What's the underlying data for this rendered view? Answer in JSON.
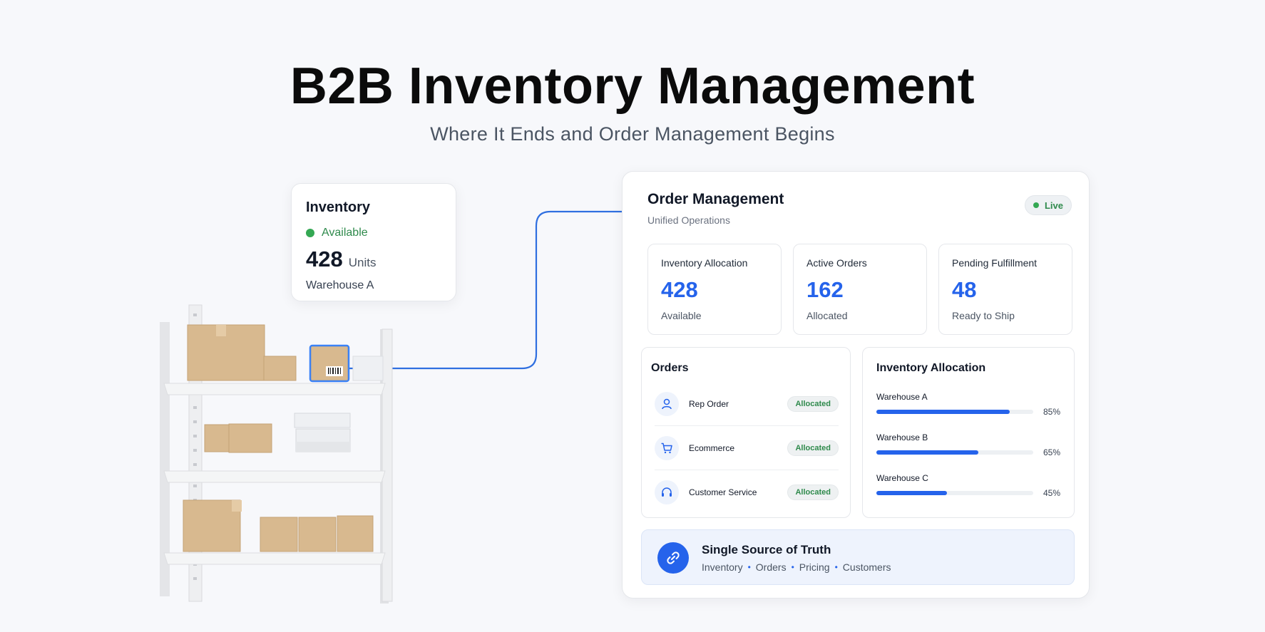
{
  "page": {
    "title": "B2B Inventory Management",
    "subtitle": "Where It Ends and Order Management Begins"
  },
  "inventory_card": {
    "title": "Inventory",
    "status": "Available",
    "quantity": "428",
    "unit": "Units",
    "warehouse": "Warehouse A"
  },
  "order_panel": {
    "title": "Order Management",
    "subtitle": "Unified Operations",
    "live_badge": "Live",
    "stats": [
      {
        "label": "Inventory Allocation",
        "value": "428",
        "sub": "Available"
      },
      {
        "label": "Active Orders",
        "value": "162",
        "sub": "Allocated"
      },
      {
        "label": "Pending Fulfillment",
        "value": "48",
        "sub": "Ready to Ship"
      }
    ],
    "orders": {
      "title": "Orders",
      "items": [
        {
          "name": "Rep Order",
          "status": "Allocated",
          "icon": "user-icon"
        },
        {
          "name": "Ecommerce",
          "status": "Allocated",
          "icon": "cart-icon"
        },
        {
          "name": "Customer Service",
          "status": "Allocated",
          "icon": "headset-icon"
        }
      ]
    },
    "allocation": {
      "title": "Inventory Allocation",
      "warehouses": [
        {
          "name": "Warehouse A",
          "percent": 85,
          "label": "85%"
        },
        {
          "name": "Warehouse B",
          "percent": 65,
          "label": "65%"
        },
        {
          "name": "Warehouse C",
          "percent": 45,
          "label": "45%"
        }
      ]
    },
    "truth": {
      "title": "Single Source of Truth",
      "items": [
        "Inventory",
        "Orders",
        "Pricing",
        "Customers"
      ],
      "icon": "link-icon"
    }
  },
  "colors": {
    "accent": "#2563eb",
    "success": "#34a853",
    "background": "#f7f8fb"
  }
}
